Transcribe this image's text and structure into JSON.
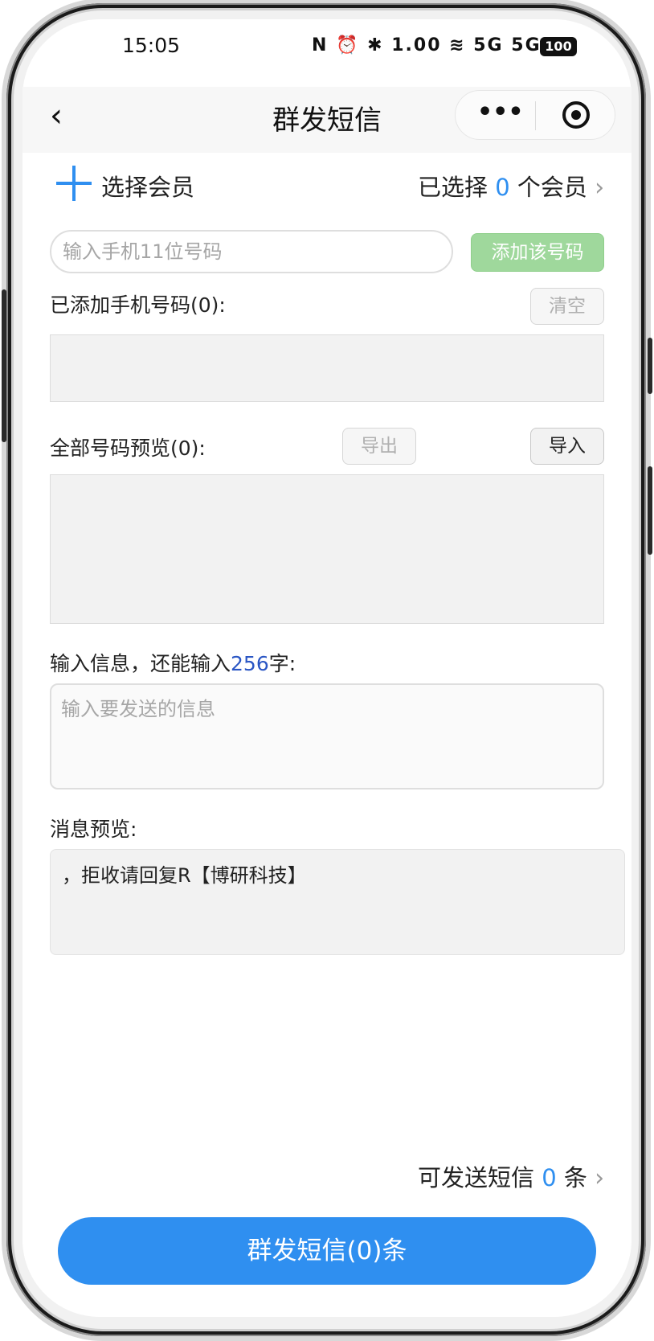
{
  "status_bar": {
    "time": "15:05",
    "icons_text": "N ⏰ ✱ 1.00 ≋ 5G 5G",
    "battery": "100"
  },
  "navbar": {
    "title": "群发短信",
    "back_icon": "chevron-left-icon",
    "more_icon": "more-dots-icon",
    "target_icon": "close-target-icon"
  },
  "member": {
    "select_label": "选择会员",
    "selected_prefix": "已选择",
    "selected_count": "0",
    "selected_suffix": "个会员"
  },
  "phone": {
    "placeholder": "输入手机11位号码",
    "add_button": "添加该号码"
  },
  "added": {
    "label": "已添加手机号码(0):",
    "clear_button": "清空"
  },
  "all_numbers": {
    "label": "全部号码预览(0):",
    "export_button": "导出",
    "import_button": "导入"
  },
  "message": {
    "label_prefix": "输入信息，还能输入",
    "remaining": "256",
    "label_suffix": "字:",
    "placeholder": "输入要发送的信息"
  },
  "preview": {
    "label": "消息预览:",
    "content": "，拒收请回复R【博研科技】"
  },
  "footer": {
    "sendable_prefix": "可发送短信",
    "sendable_count": "0",
    "sendable_suffix": "条",
    "send_button": "群发短信(0)条"
  },
  "colors": {
    "accent": "#2f8ff0",
    "add_button_bg": "#9fd89c",
    "box_bg": "#f2f2f2"
  }
}
